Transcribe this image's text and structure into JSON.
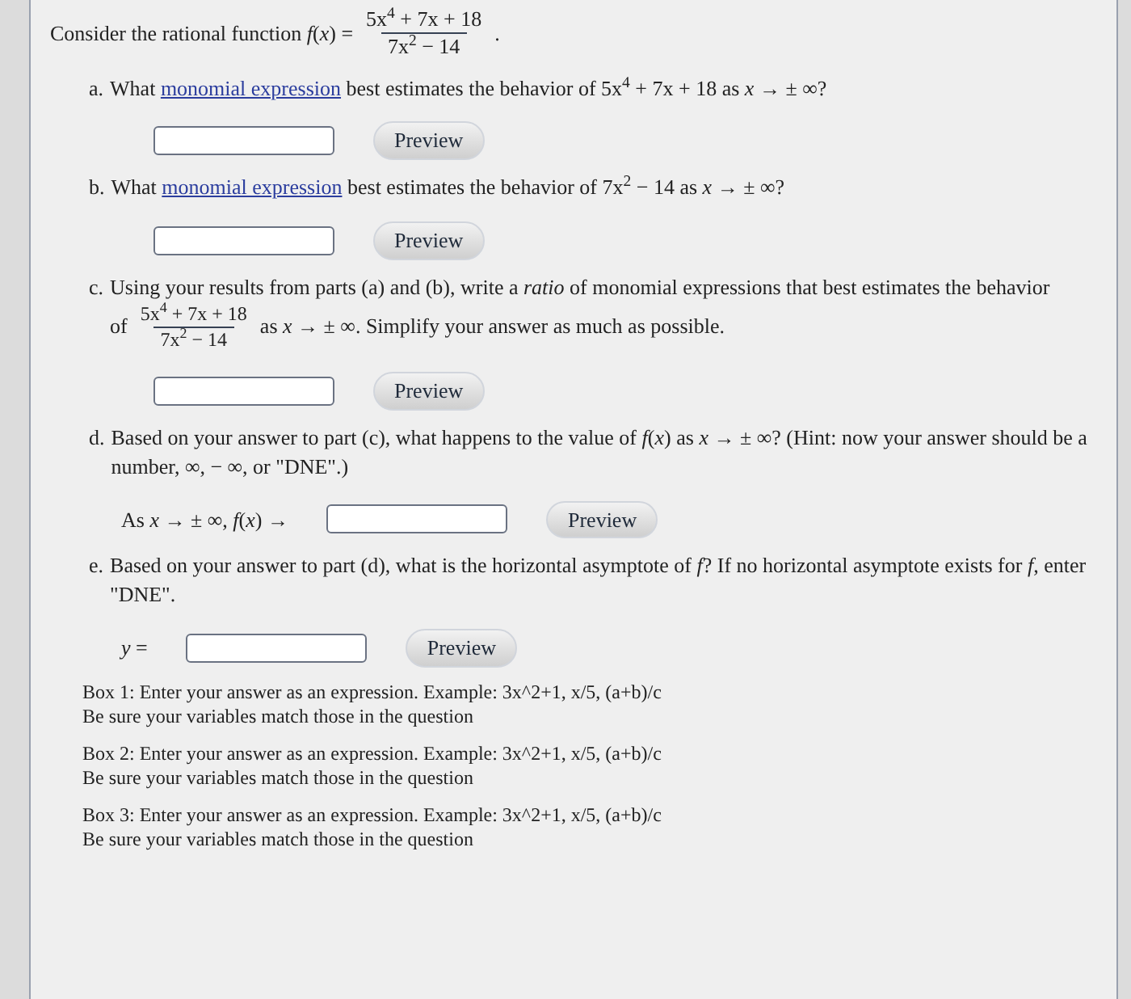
{
  "intro": {
    "text": "Consider the rational function *f*(*x*) =",
    "fraction": {
      "numerator": "5x$^{4}$ + 7x + 18",
      "denominator": "7x$^{2}$ − 14"
    },
    "after": "."
  },
  "parts": [
    {
      "kind": "link",
      "label": "a.",
      "before": "What",
      "link": "monomial expression",
      "after": "best estimates the behavior of 5x$^{4}$ + 7x + 18 as *x* → ± ∞?",
      "answer": {
        "button": "Preview"
      }
    },
    {
      "kind": "link",
      "label": "b.",
      "before": "What",
      "link": "monomial expression",
      "after": "best estimates the behavior of 7x$^{2}$ − 14 as *x* → ± ∞?",
      "answer": {
        "button": "Preview"
      }
    },
    {
      "kind": "fraction",
      "label": "c.",
      "text": "Using your results from parts (a) and (b), write a *ratio* of monomial expressions that best estimates the behavior",
      "of": "of",
      "fraction": {
        "numerator": "5x$^{4}$ + 7x + 18",
        "denominator": "7x$^{2}$ − 14"
      },
      "after": "as *x* → ± ∞. Simplify your answer as much as possible.",
      "answer": {
        "button": "Preview"
      }
    },
    {
      "kind": "text",
      "label": "d.",
      "text": "Based on your answer to part (c), what happens to the value of *f*(*x*) as *x* → ± ∞? (Hint: now your answer should be a number, ∞, − ∞, or \"DNE\".)",
      "answer": {
        "prefix": "As *x* → ± ∞, *f*(*x*) →",
        "button": "Preview"
      }
    },
    {
      "kind": "text",
      "label": "e.",
      "text": "Based on your answer to part (d), what is the horizontal asymptote of *f*? If no horizontal asymptote exists for *f*, enter \"DNE\".",
      "answer": {
        "prefix": "*y* =",
        "button": "Preview"
      }
    }
  ],
  "notes": [
    {
      "lines": [
        "Box 1: Enter your answer as an expression. Example: 3x^2+1, x/5, (a+b)/c",
        "Be sure your variables match those in the question"
      ]
    },
    {
      "lines": [
        "Box 2: Enter your answer as an expression. Example: 3x^2+1, x/5, (a+b)/c",
        "Be sure your variables match those in the question"
      ]
    },
    {
      "lines": [
        "Box 3: Enter your answer as an expression. Example: 3x^2+1, x/5, (a+b)/c",
        "Be sure your variables match those in the question"
      ]
    }
  ]
}
